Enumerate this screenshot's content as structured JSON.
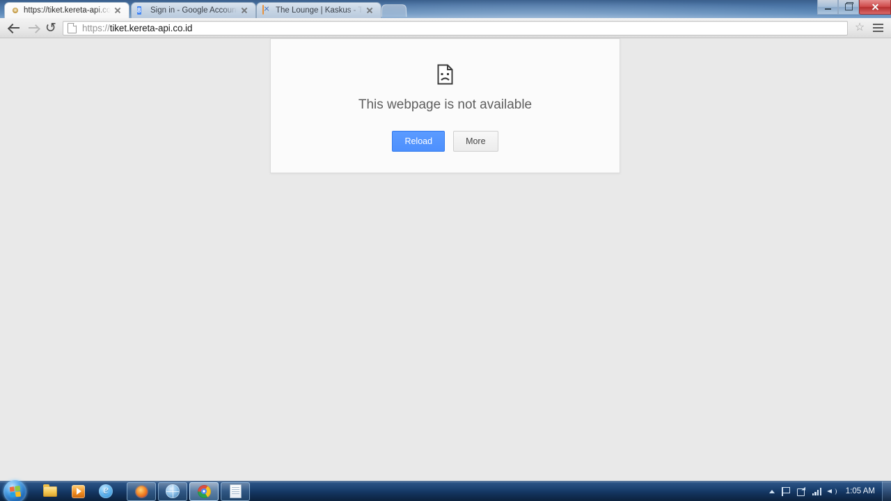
{
  "browser": {
    "tabs": [
      {
        "title": "https://tiket.kereta-api.co",
        "favicon": "kai-logo-icon",
        "active": true
      },
      {
        "title": "Sign in - Google Accounts",
        "favicon": "google-icon",
        "active": false
      },
      {
        "title": "The Lounge | Kaskus - The",
        "favicon": "broken-image-icon",
        "active": false
      }
    ],
    "new_tab_label": "",
    "window_controls": {
      "minimize": "minimize-button",
      "maximize": "maximize-button",
      "close": "close-button"
    },
    "toolbar": {
      "back": "Back",
      "forward": "Forward",
      "reload": "Reload",
      "url_scheme": "https://",
      "url_host": "tiket.kereta-api.co.id",
      "bookmark_star": "☆",
      "menu": "Customize and control Google Chrome"
    }
  },
  "page": {
    "icon": "sad-page-icon",
    "title": "This webpage is not available",
    "buttons": {
      "reload": "Reload",
      "more": "More"
    },
    "colors": {
      "background": "#e9e9e9",
      "card": "#fbfbfb",
      "primary_button": "#4d90fe",
      "title_text": "#5e5e5e"
    }
  },
  "taskbar": {
    "start": "Start",
    "quick_launch": [
      {
        "name": "file-explorer",
        "label": "Windows Explorer"
      },
      {
        "name": "windows-media-player",
        "label": "Windows Media Player"
      },
      {
        "name": "internet-explorer",
        "label": "Internet Explorer"
      }
    ],
    "running": [
      {
        "name": "firefox",
        "label": "Mozilla Firefox",
        "active": false
      },
      {
        "name": "network-app",
        "label": "Network Application",
        "active": false
      },
      {
        "name": "chrome",
        "label": "Google Chrome",
        "active": true
      },
      {
        "name": "notepad",
        "label": "Notepad",
        "active": false
      }
    ],
    "tray": {
      "show_hidden": "Show hidden icons",
      "icons": [
        {
          "name": "action-center-flag-icon",
          "label": "Action Center"
        },
        {
          "name": "safely-remove-hardware-icon",
          "label": "Safely Remove Hardware"
        },
        {
          "name": "network-signal-icon",
          "label": "Network"
        },
        {
          "name": "volume-icon",
          "label": "Volume"
        }
      ],
      "clock": "1:05 AM"
    }
  }
}
